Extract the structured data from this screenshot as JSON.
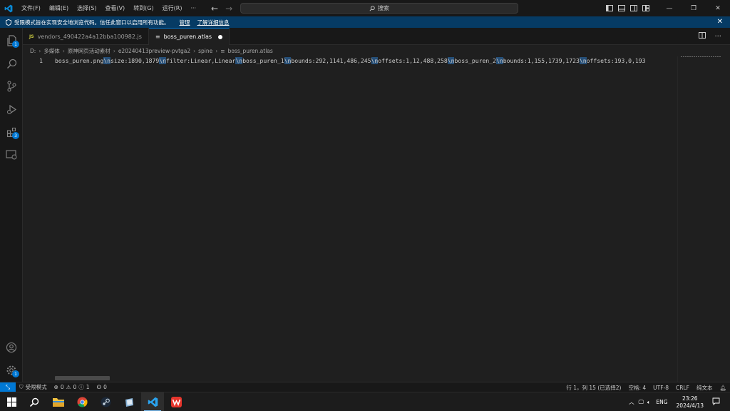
{
  "titlebar": {
    "menu": [
      "文件(F)",
      "编辑(E)",
      "选择(S)",
      "查看(V)",
      "转到(G)",
      "运行(R)",
      "···"
    ],
    "search_placeholder": "搜索"
  },
  "banner": {
    "message": "受限模式旨在实现安全地浏览代码。信任此窗口以启用所有功能。",
    "manage_link": "管理",
    "learn_more_link": "了解详细信息"
  },
  "activitybar": {
    "explorer_badge": "1",
    "extensions_badge": "3",
    "settings_badge": "1"
  },
  "tabs": [
    {
      "icon_text": "JS",
      "label": "vendors_490422a4a12bba100982.js",
      "active": false
    },
    {
      "icon_text": "≡",
      "label": "boss_puren.atlas",
      "active": true,
      "dirty": true
    }
  ],
  "breadcrumb": [
    "D:",
    "多媒体",
    "原神网页活动素材",
    "e20240413preview-pvtga2",
    "spine",
    "boss_puren.atlas"
  ],
  "editor": {
    "line_number": "1",
    "segments": [
      {
        "text": "boss_puren.png",
        "esc": false
      },
      {
        "text": "\\n",
        "esc": true
      },
      {
        "text": "size:1890,1879",
        "esc": false
      },
      {
        "text": "\\n",
        "esc": true
      },
      {
        "text": "filter:Linear,Linear",
        "esc": false
      },
      {
        "text": "\\n",
        "esc": true
      },
      {
        "text": "boss_puren_1",
        "esc": false
      },
      {
        "text": "\\n",
        "esc": true
      },
      {
        "text": "bounds:292,1141,486,245",
        "esc": false
      },
      {
        "text": "\\n",
        "esc": true
      },
      {
        "text": "offsets:1,12,488,258",
        "esc": false
      },
      {
        "text": "\\n",
        "esc": true
      },
      {
        "text": "boss_puren_2",
        "esc": false
      },
      {
        "text": "\\n",
        "esc": true
      },
      {
        "text": "bounds:1,155,1739,1723",
        "esc": false
      },
      {
        "text": "\\n",
        "esc": true
      },
      {
        "text": "offsets:193,0,193",
        "esc": false
      }
    ]
  },
  "statusbar": {
    "restricted_mode": "受限模式",
    "errors": "0",
    "warnings": "0",
    "infos": "1",
    "ports": "0",
    "cursor": "行 1，列 15 (已选择2)",
    "spaces": "空格: 4",
    "encoding": "UTF-8",
    "eol": "CRLF",
    "language": "纯文本"
  },
  "taskbar": {
    "lang": "ENG",
    "time": "23:26",
    "date": "2024/4/13"
  },
  "colors": {
    "accent": "#0078d4",
    "banner": "#063b64"
  }
}
